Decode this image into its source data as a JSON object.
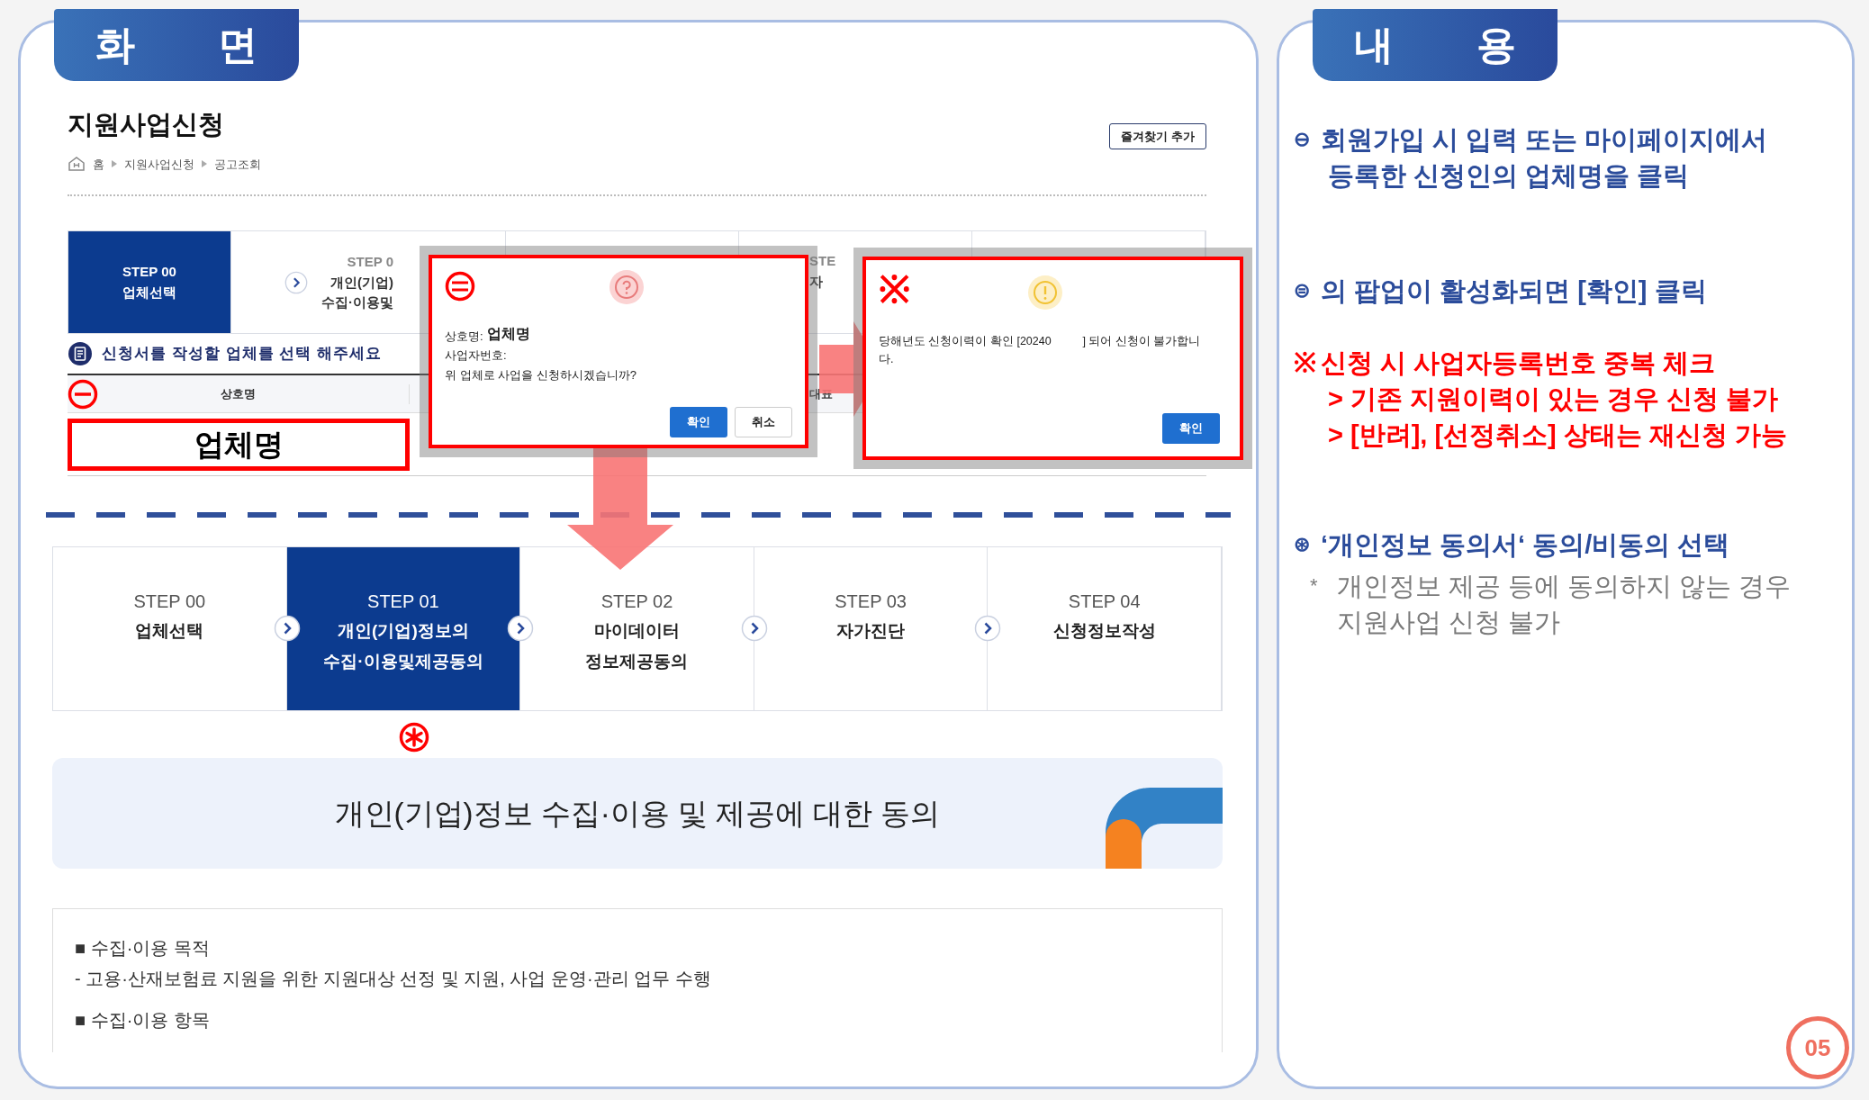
{
  "screen_panel": {
    "tab": "화 면",
    "page": {
      "title": "지원사업신청",
      "breadcrumb": [
        "홈",
        "지원사업신청",
        "공고조회"
      ],
      "favorite_button": "즐겨찾기 추가",
      "steps": [
        {
          "label": "STEP 00",
          "lines": [
            "업체선택"
          ],
          "selected": true,
          "chevron": true
        },
        {
          "label": "STEP 0",
          "lines": [
            "개인(기업)",
            "수집·이용및"
          ],
          "selected": false,
          "chevron": false
        },
        {
          "selected": false,
          "chevron": false
        },
        {
          "label": "STE",
          "lines": [
            "자"
          ],
          "selected": false,
          "chevron": false
        },
        {
          "selected": false,
          "chevron": false
        }
      ],
      "select_prompt": "신청서를 작성할 업체를 선택 해주세요",
      "table": {
        "columns": [
          "상호명",
          "대표"
        ],
        "rows": [
          [
            "업체명"
          ]
        ]
      }
    },
    "popup_confirm": {
      "company_label": "상호명:",
      "company": "업체명",
      "business_no_label": "사업자번호:",
      "question": "위 업체로 사업을 신청하시겠습니까?",
      "buttons": [
        {
          "label": "확인",
          "kind": "primary"
        },
        {
          "label": "취소",
          "kind": "secondary"
        }
      ]
    },
    "popup_duplicate": {
      "mark": "※",
      "message": "당해년도 신청이력이 확인 [20240          ] 되어 신청이 불가합니다.",
      "button": "확인"
    },
    "next_page": {
      "steps": [
        {
          "label": "STEP 00",
          "lines": [
            "업체선택"
          ],
          "selected": false
        },
        {
          "label": "STEP 01",
          "lines": [
            "개인(기업)정보의",
            "수집·이용및제공동의"
          ],
          "selected": true
        },
        {
          "label": "STEP 02",
          "lines": [
            "마이데이터",
            "정보제공동의"
          ],
          "selected": false
        },
        {
          "label": "STEP 03",
          "lines": [
            "자가진단"
          ],
          "selected": false
        },
        {
          "label": "STEP 04",
          "lines": [
            "신청정보작성"
          ],
          "selected": false
        }
      ],
      "banner_title": "개인(기업)정보 수집·이용 및 제공에 대한 동의",
      "content": [
        {
          "kind": "heading",
          "text": "■ 수집·이용 목적"
        },
        {
          "kind": "item",
          "text": "- 고용·산재보험료 지원을 위한 지원대상 선정 및 지원, 사업 운영·관리 업무 수행"
        },
        {
          "kind": "heading",
          "text": "■ 수집·이용 항목"
        }
      ]
    }
  },
  "content_panel": {
    "tab": "내 용",
    "notes": [
      {
        "kind": "step",
        "mark": "⊖",
        "lines": [
          "회원가입 시 입력 또는 마이페이지에서",
          "등록한 신청인의 업체명을 클릭"
        ]
      },
      {
        "kind": "step",
        "mark": "⊜",
        "lines": [
          "의 팝업이 활성화되면 [확인] 클릭"
        ]
      },
      {
        "kind": "warning",
        "mark": "※",
        "lines": [
          "신청 시 사업자등록번호 중복 체크",
          "> 기존 지원이력이 있는 경우 신청 불가",
          "> [반려], [선정취소] 상태는 재신청 가능"
        ]
      },
      {
        "kind": "step",
        "mark": "⊛",
        "lines": [
          "‘개인정보 동의서‘ 동의/비동의 선택"
        ]
      },
      {
        "kind": "note",
        "mark": "*",
        "lines": [
          "개인정보 제공 등에 동의하지 않는 경우",
          "지원사업 신청 불가"
        ]
      }
    ],
    "page_number": "05"
  }
}
